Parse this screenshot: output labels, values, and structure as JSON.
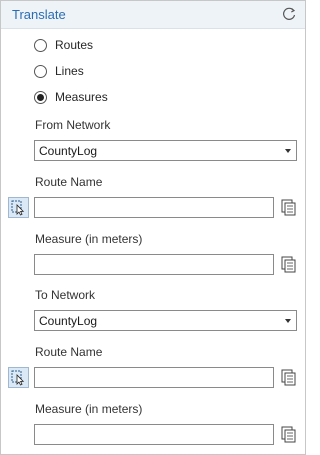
{
  "panel": {
    "title": "Translate",
    "refresh_icon": "refresh-icon"
  },
  "radio_options": [
    {
      "label": "Routes",
      "checked": false
    },
    {
      "label": "Lines",
      "checked": false
    },
    {
      "label": "Measures",
      "checked": true
    }
  ],
  "from_network": {
    "label": "From Network",
    "value": "CountyLog",
    "route_name_label": "Route Name",
    "route_name_value": "",
    "measure_label": "Measure (in meters)",
    "measure_value": ""
  },
  "to_network": {
    "label": "To Network",
    "value": "CountyLog",
    "route_name_label": "Route Name",
    "route_name_value": "",
    "measure_label": "Measure (in meters)",
    "measure_value": ""
  },
  "icons": {
    "pick": "pick-from-map-icon",
    "copy": "copy-icon",
    "dropdown": "chevron-down-icon"
  },
  "colors": {
    "title": "#2b6db3",
    "header_bg": "#eef3f8",
    "pick_bg": "#dbe8f5"
  }
}
